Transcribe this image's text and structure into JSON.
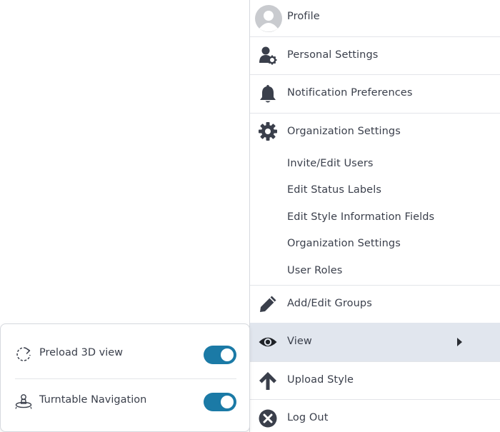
{
  "menu": {
    "profile": {
      "label": "Profile",
      "icon": "avatar-icon"
    },
    "personal_settings": {
      "label": "Personal Settings",
      "icon": "user-gear-icon"
    },
    "notification_preferences": {
      "label": "Notification Preferences",
      "icon": "bell-icon"
    },
    "organization_settings": {
      "label": "Organization Settings",
      "icon": "gear-icon"
    },
    "sub_items": [
      {
        "label": "Invite/Edit Users"
      },
      {
        "label": "Edit Status Labels"
      },
      {
        "label": "Edit Style Information Fields"
      },
      {
        "label": "Organization Settings"
      },
      {
        "label": "User Roles"
      }
    ],
    "add_edit_groups": {
      "label": "Add/Edit Groups",
      "icon": "pencil-icon"
    },
    "view": {
      "label": "View",
      "icon": "eye-icon",
      "active": true,
      "has_submenu": true
    },
    "upload_style": {
      "label": "Upload Style",
      "icon": "arrow-up-icon"
    },
    "log_out": {
      "label": "Log Out",
      "icon": "close-circle-icon"
    }
  },
  "view_settings": {
    "preload_3d": {
      "label": "Preload 3D view",
      "icon": "refresh-dashed-icon",
      "enabled": true
    },
    "turntable": {
      "label": "Turntable Navigation",
      "icon": "turntable-icon",
      "enabled": true
    }
  },
  "colors": {
    "toggle_on": "#1b7aa6",
    "active_row": "#e1e6ee",
    "icon": "#3a3f4b"
  }
}
